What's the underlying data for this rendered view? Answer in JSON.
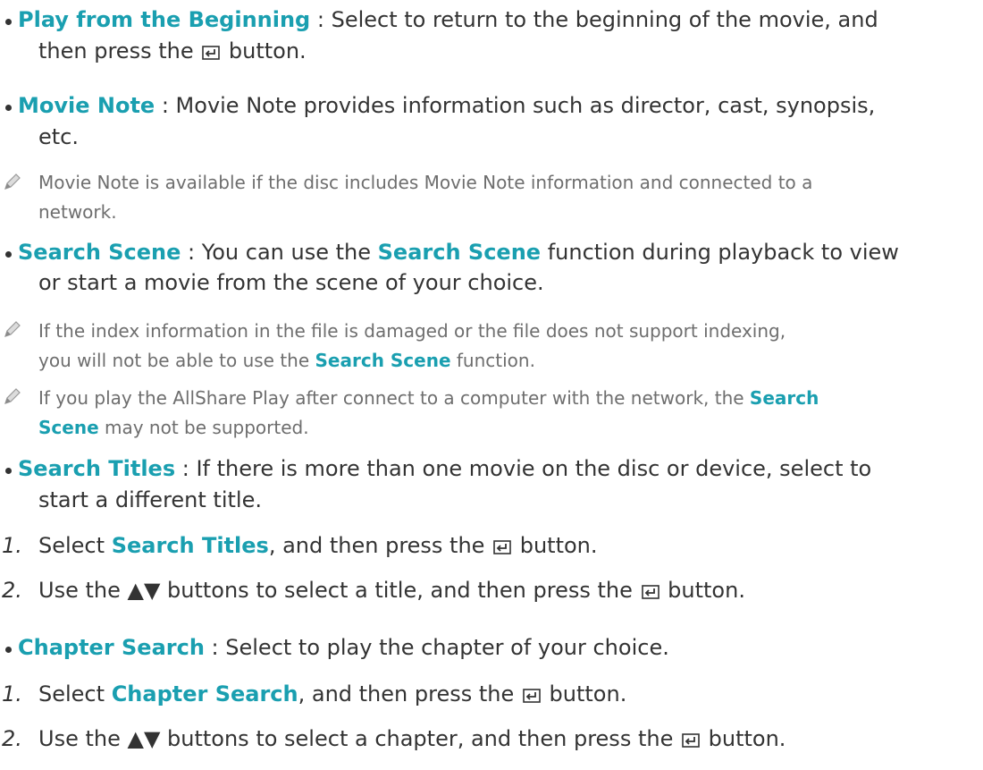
{
  "items": {
    "play_from_beginning": {
      "label": "Play from the Beginning",
      "sep": " : ",
      "text1": "Select to return to the beginning of the movie, and",
      "text2a": "then press the",
      "text2b": "button."
    },
    "movie_note": {
      "label": "Movie Note",
      "sep": " : ",
      "text1": "Movie Note provides information such as director, cast, synopsis,",
      "text2": "etc."
    },
    "movie_note_tip": {
      "line1": "Movie Note is available if the disc includes Movie Note information and connected to a",
      "line2": "network."
    },
    "search_scene": {
      "label": "Search Scene",
      "sep": " : ",
      "text1a": "You can use the",
      "text1b": "Search Scene",
      "text1c": "function during playback to view",
      "text2": "or start a movie from the scene of your choice."
    },
    "search_scene_tip1": {
      "line1": "If the index information in the file is damaged or the file does not support indexing,",
      "line2a": "you will not be able to use the",
      "line2b": "Search Scene",
      "line2c": "function."
    },
    "search_scene_tip2": {
      "line1a": "If you play the AllShare Play after connect to a computer with the network, the",
      "line1b": "Search",
      "line2a": "Scene",
      "line2b": "may not be supported."
    },
    "search_titles": {
      "label": "Search Titles",
      "sep": " : ",
      "text1": "If there is more than one movie on the disc or device, select to",
      "text2": "start a different title."
    },
    "search_titles_steps": [
      {
        "num": "1.",
        "a": "Select",
        "b": "Search Titles",
        "c": ", and then press the",
        "d": "button."
      },
      {
        "num": "2.",
        "a": "Use the ▲▼ buttons to select a title, and then press the",
        "d": "button."
      }
    ],
    "chapter_search": {
      "label": "Chapter Search",
      "sep": " : ",
      "text1": "Select to play the chapter of your choice."
    },
    "chapter_search_steps": [
      {
        "num": "1.",
        "a": "Select",
        "b": "Chapter Search",
        "c": ", and then press the",
        "d": "button."
      },
      {
        "num": "2.",
        "a": "Use the ▲▼ buttons to select a chapter, and then press the",
        "d": "button."
      }
    ]
  },
  "icons": {
    "enter": "enter-button-icon",
    "note": "pencil-note-icon"
  },
  "colors": {
    "highlight": "#1a9fb0",
    "text": "#333333",
    "note_text": "#6e6e6e"
  }
}
